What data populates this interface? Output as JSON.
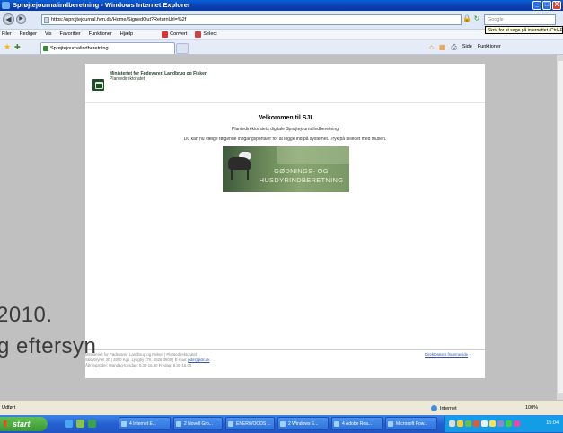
{
  "window": {
    "title": "Sprøjtejournalindberetning - Windows Internet Explorer",
    "buttons": {
      "minimize": "_",
      "maximize": "□",
      "close": "X"
    }
  },
  "addressbar": {
    "back": "◀",
    "forward": "▶",
    "url": "https://sprojtejournal.fvm.dk/Home/SignedOut?ReturnUrl=%2f",
    "search_placeholder": "Google",
    "tooltip": "Skriv for at søge på internettet (Ctrl+E)"
  },
  "menubar": {
    "items": [
      "Filer",
      "Rediger",
      "Vis",
      "Favoritter",
      "Funktioner",
      "Hjælp"
    ],
    "convert": "Convert",
    "select": "Select"
  },
  "tabs": {
    "active_tab": "Sprøjtejournalindberetning"
  },
  "commandbar": {
    "side": "Side",
    "funktioner": "Funktioner"
  },
  "page": {
    "ministry_name": "Ministeriet for Fødevarer, Landbrug og Fiskeri",
    "ministry_sub": "Plantedirektoratet",
    "welcome_title": "Velkommen til SJI",
    "intro_line1": "Plantedirektoratets digitale Sprøjtejournalindberetning",
    "intro_line2": "Du kan nu vælge følgende indgangsportaler for at logge ind på systemet. Tryk på billedet med musen.",
    "banner_line1": "GØDNINGS- OG",
    "banner_line2": "HUSDYRINDBERETNING",
    "footer_line1": "Ministeriet for Fødevarer, Landbrug og Fiskeri | Plantedirektoratet",
    "footer_line2": "Skovbrynet 20 | 2800 Kgs. Lyngby | Tlf. 4526 3600 | E-mail:",
    "footer_email": "pdir@pdir.dk",
    "footer_line3": "Åbningstider: Mandag-torsdag: 8.30-15.30 Fredag: 8.30-15.00",
    "footer_link": "Direktoratets frammeside"
  },
  "overlay": {
    "line1": "2010.",
    "line2": "g eftersyn"
  },
  "statusbar": {
    "status": "Udført",
    "zone": "Internet",
    "zoom": "100%"
  },
  "taskbar": {
    "start": "start",
    "buttons": [
      "4 Internet E...",
      "2 Novell Gro...",
      "ENERWOODS ...",
      "2 Windows E...",
      "4 Adobe Rea...",
      "Microsoft Pow..."
    ],
    "clock": "15:04"
  }
}
